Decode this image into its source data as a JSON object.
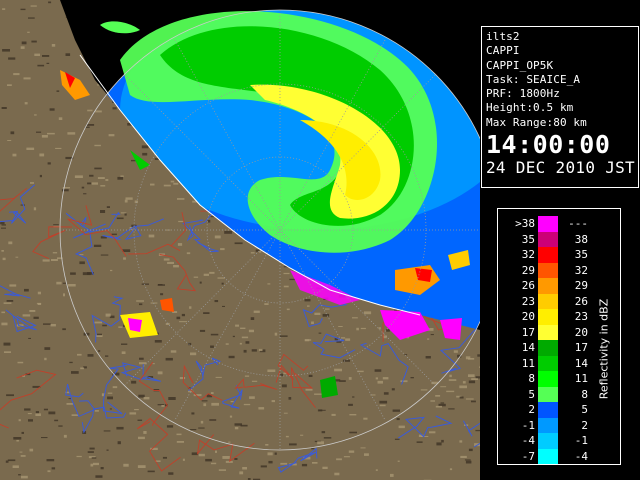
{
  "info": {
    "station": "ilts2",
    "product": "CAPPI",
    "product_code": "CAPPI_OP5K",
    "task": "Task: SEAICE_A",
    "prf": "PRF: 1800Hz",
    "height": "Height:0.5 km",
    "max_range": "Max Range:80 km",
    "time": "14:00:00",
    "date": "24 DEC 2010 JST"
  },
  "legend": {
    "unit": "Reflectivity in dBZ",
    "rows": [
      {
        "lo": ">38",
        "hi": "---",
        "color": "#ff00ff"
      },
      {
        "lo": "35",
        "hi": "38",
        "color": "#cc0077"
      },
      {
        "lo": "32",
        "hi": "35",
        "color": "#ff0000"
      },
      {
        "lo": "29",
        "hi": "32",
        "color": "#ff5500"
      },
      {
        "lo": "26",
        "hi": "29",
        "color": "#ff9900"
      },
      {
        "lo": "23",
        "hi": "26",
        "color": "#ffcc00"
      },
      {
        "lo": "20",
        "hi": "23",
        "color": "#ffee00"
      },
      {
        "lo": "17",
        "hi": "20",
        "color": "#ffff33"
      },
      {
        "lo": "14",
        "hi": "17",
        "color": "#00aa00"
      },
      {
        "lo": "11",
        "hi": "14",
        "color": "#00cc00"
      },
      {
        "lo": "8",
        "hi": "11",
        "color": "#00ff00"
      },
      {
        "lo": "5",
        "hi": "8",
        "color": "#55ff55"
      },
      {
        "lo": "2",
        "hi": "5",
        "color": "#0055ff"
      },
      {
        "lo": "-1",
        "hi": "2",
        "color": "#0099ff"
      },
      {
        "lo": "-4",
        "hi": "-1",
        "color": "#00ccff"
      },
      {
        "lo": "-7",
        "hi": "-4",
        "color": "#00ffff"
      }
    ]
  },
  "map": {
    "land_color": "#7a6a4e",
    "sea_color": "#000000",
    "coverage_color": "#0066ff",
    "rivers_color": "#3b5bd6",
    "boundary_color": "#c0402a",
    "range_ring_color": "#9a9a9a"
  }
}
